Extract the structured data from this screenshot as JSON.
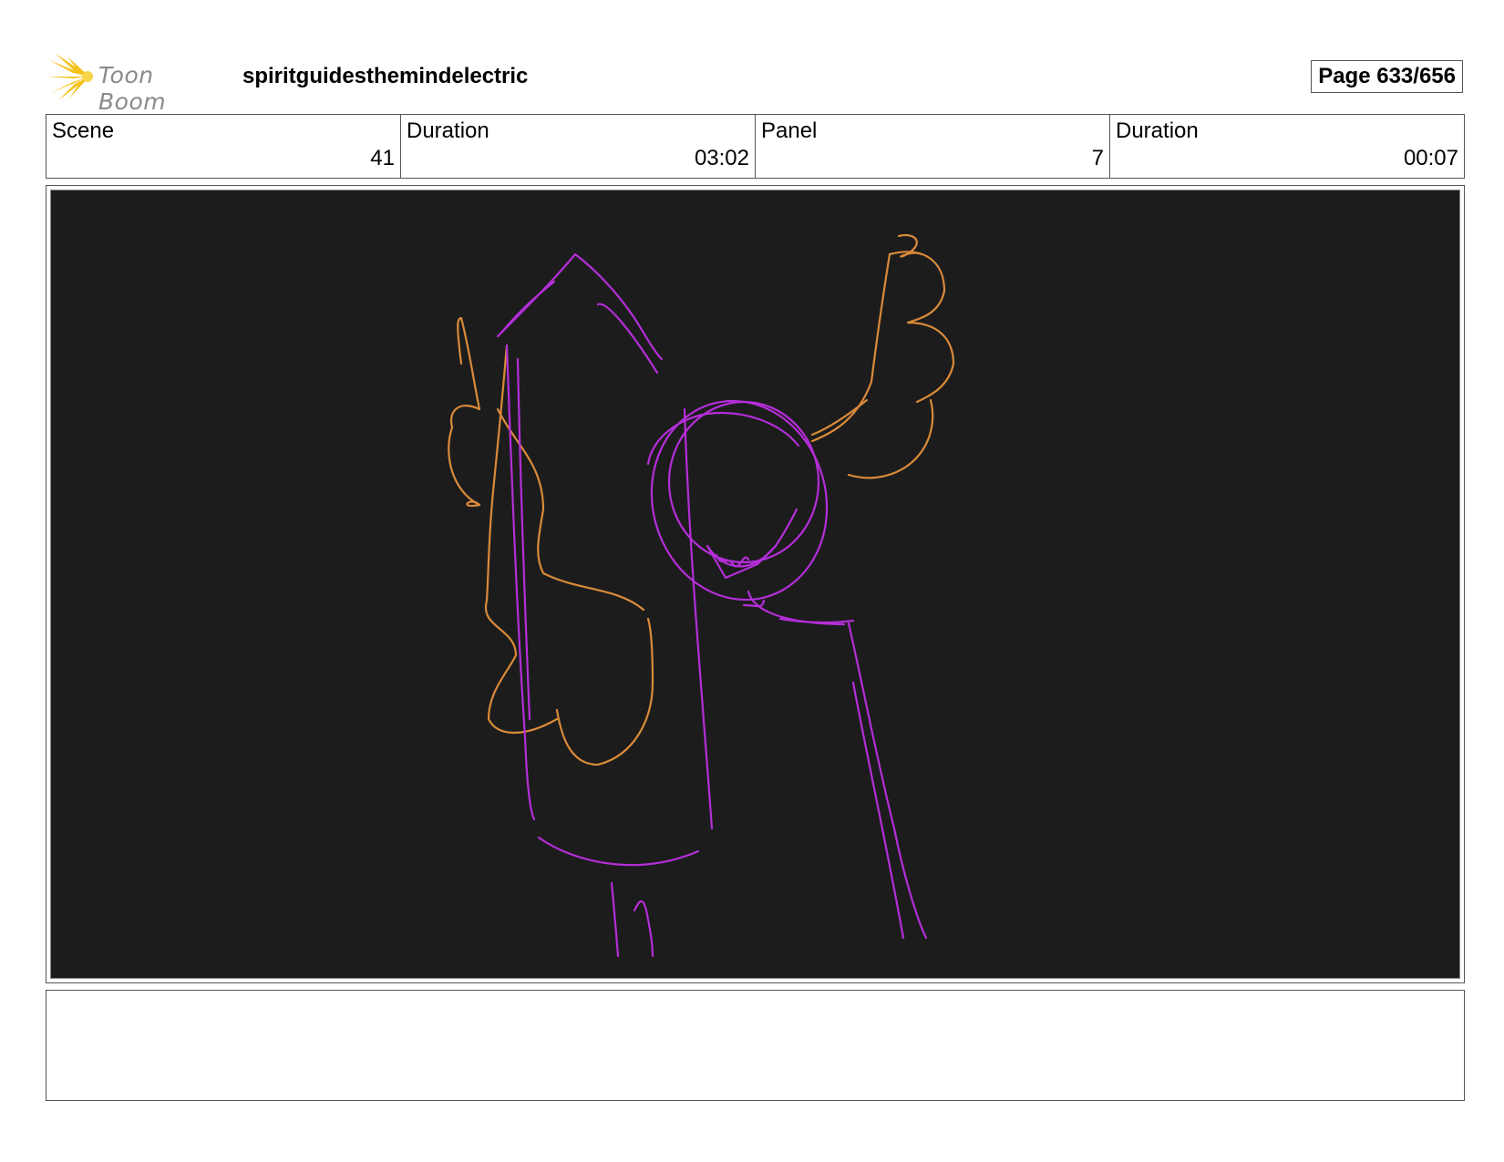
{
  "header": {
    "brand": "Toon Boom",
    "project_title": "spiritguidesthemindelectric",
    "page_label": "Page 633/656"
  },
  "info": {
    "scene_label": "Scene",
    "scene_value": "41",
    "scene_duration_label": "Duration",
    "scene_duration_value": "03:02",
    "panel_label": "Panel",
    "panel_value": "7",
    "panel_duration_label": "Duration",
    "panel_duration_value": "00:07"
  },
  "colors": {
    "panel_background": "#1c1c1c",
    "sketch_orange": "#d98a3a",
    "sketch_purple": "#b42ed8",
    "logo_yellow": "#f5c21b"
  },
  "notes": ""
}
